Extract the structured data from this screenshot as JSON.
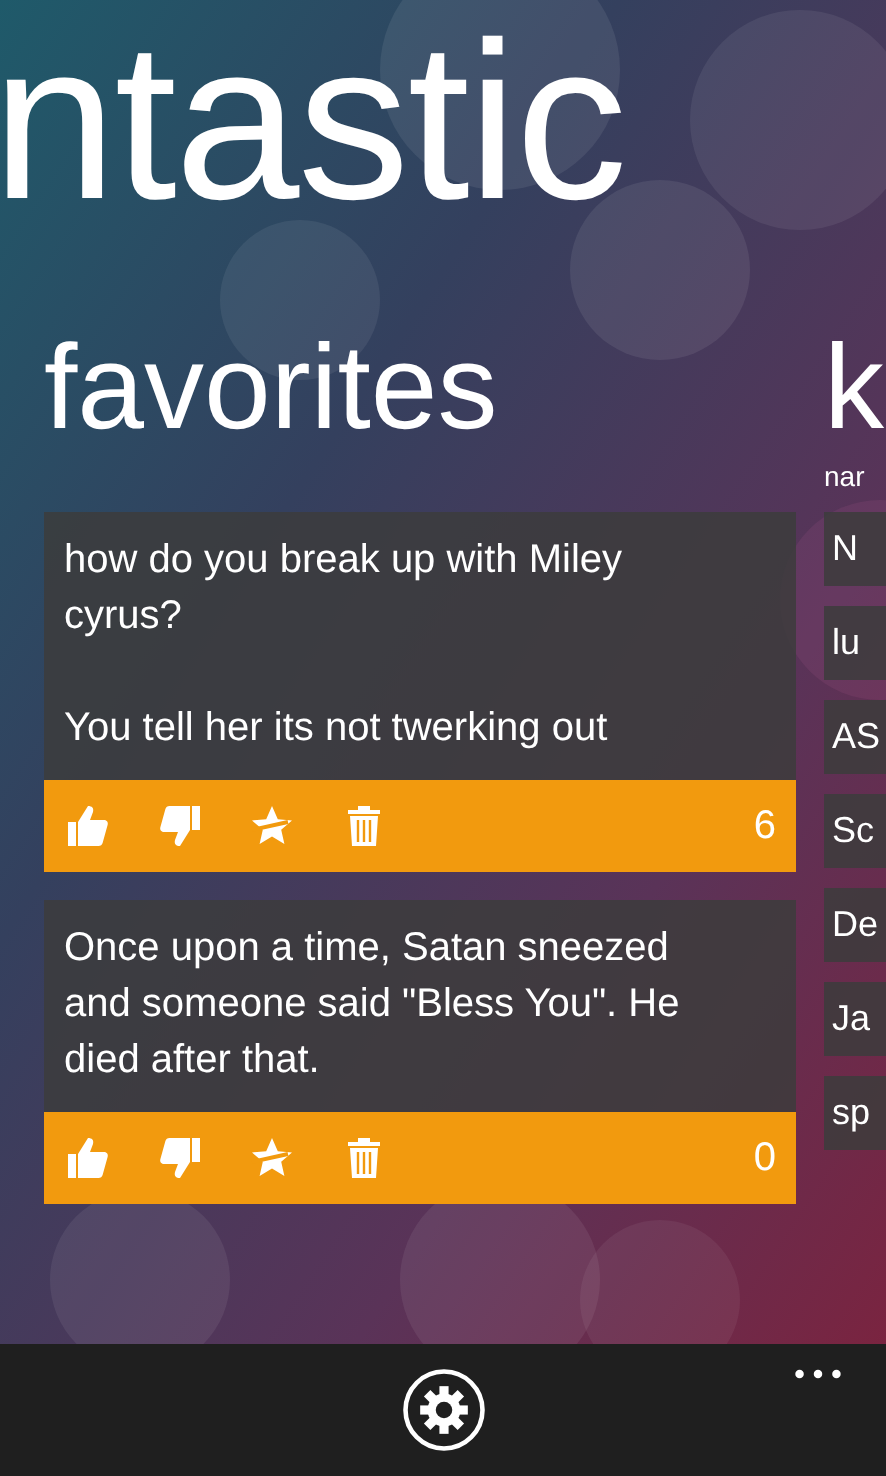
{
  "panorama": {
    "title": "ntastic"
  },
  "favorites": {
    "header": "favorites",
    "jokes": [
      {
        "text": "how do you break up with Miley cyrus?\n\nYou tell her its not twerking out",
        "score": "6"
      },
      {
        "text": "Once upon a time, Satan sneezed and someone said \"Bless You\". He died after that.",
        "score": "0"
      }
    ]
  },
  "next_section": {
    "header": "k",
    "label": "nar",
    "items": [
      "N",
      "lu",
      "AS",
      "Sc",
      "De",
      "Ja",
      "sp"
    ]
  }
}
